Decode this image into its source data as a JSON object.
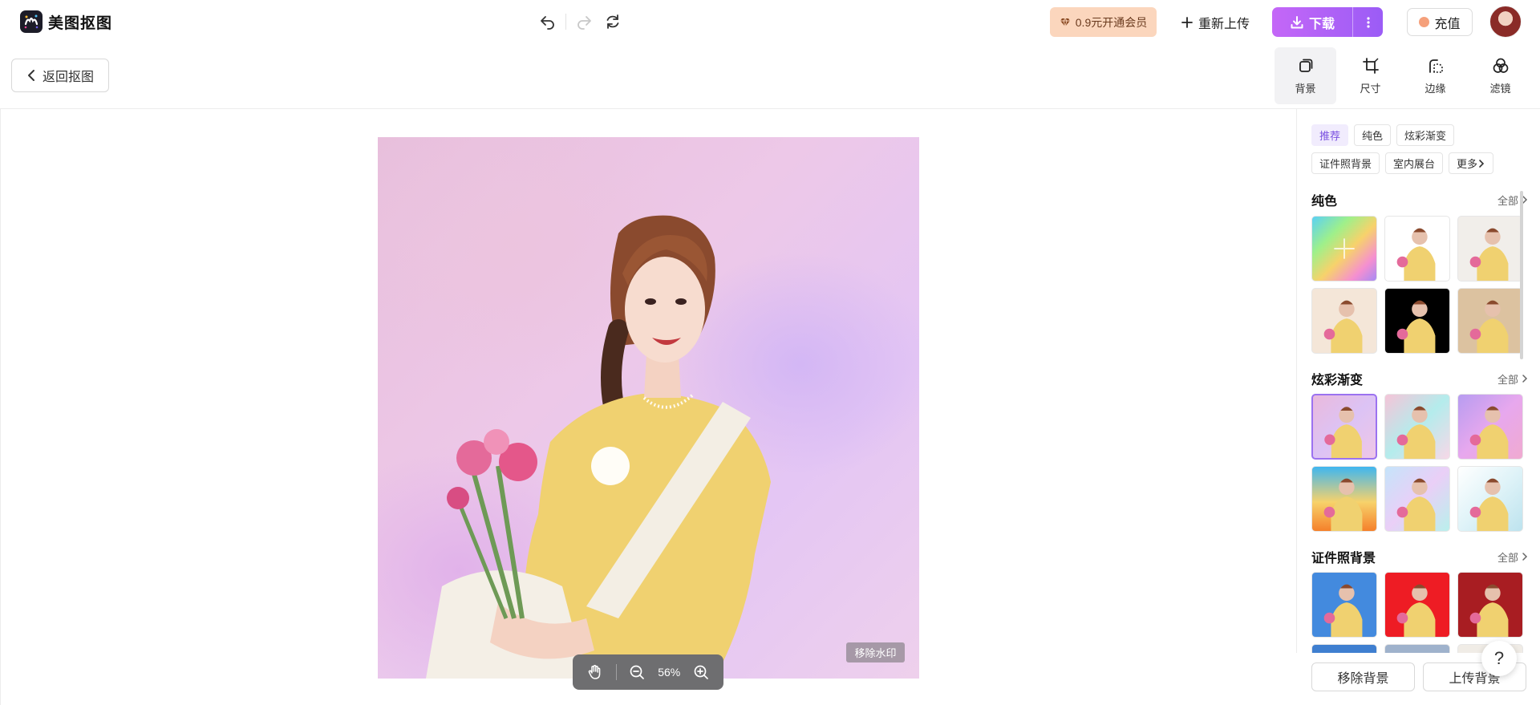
{
  "brand": {
    "name": "美图抠图",
    "logo_icon": "meitu-logo-icon"
  },
  "header": {
    "vip_label": "0.9元开通会员",
    "reupload_label": "重新上传",
    "download_label": "下载",
    "recharge_label": "充值"
  },
  "toolbar": {
    "back_label": "返回抠图",
    "tools": [
      {
        "label": "背景",
        "icon": "copy-layer-icon",
        "active": true
      },
      {
        "label": "尺寸",
        "icon": "crop-icon",
        "active": false
      },
      {
        "label": "边缘",
        "icon": "edge-icon",
        "active": false
      },
      {
        "label": "滤镜",
        "icon": "filter-icon",
        "active": false
      }
    ]
  },
  "canvas": {
    "watermark_label": "移除水印",
    "zoom_label": "56%"
  },
  "panel": {
    "chips": [
      "推荐",
      "纯色",
      "炫彩渐变",
      "证件照背景",
      "室内展台",
      "更多"
    ],
    "sections": [
      {
        "title": "纯色",
        "all_label": "全部"
      },
      {
        "title": "炫彩渐变",
        "all_label": "全部"
      },
      {
        "title": "证件照背景",
        "all_label": "全部"
      }
    ],
    "remove_bg_label": "移除背景",
    "upload_bg_label": "上传背景",
    "help_label": "?"
  },
  "colors": {
    "accent": "#9b5cf6",
    "vip_bg": "#fbd6bd",
    "id_blue": "#438ade",
    "id_red": "#ee1c24",
    "id_darkred": "#a81d22"
  }
}
